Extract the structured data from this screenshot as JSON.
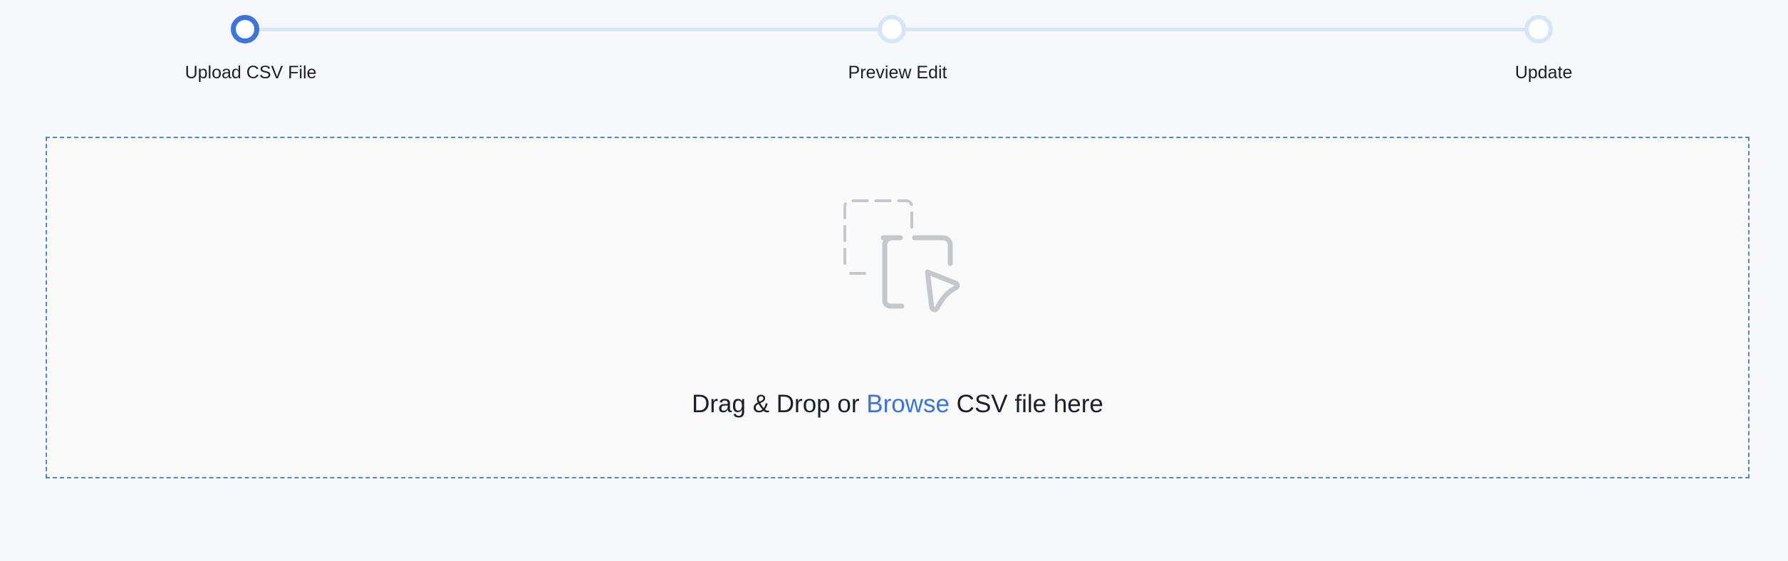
{
  "stepper": {
    "steps": [
      {
        "label": "Upload CSV File",
        "state": "active"
      },
      {
        "label": "Preview Edit",
        "state": "inactive"
      },
      {
        "label": "Update",
        "state": "inactive"
      }
    ],
    "colors": {
      "active": "#3a74dc",
      "inactive": "#d6e6fa"
    }
  },
  "dropzone": {
    "icon": "drag-drop-icon",
    "text_before": "Drag & Drop or",
    "browse_label": "Browse",
    "text_after": "CSV file here",
    "border_color": "#4a87d6"
  }
}
